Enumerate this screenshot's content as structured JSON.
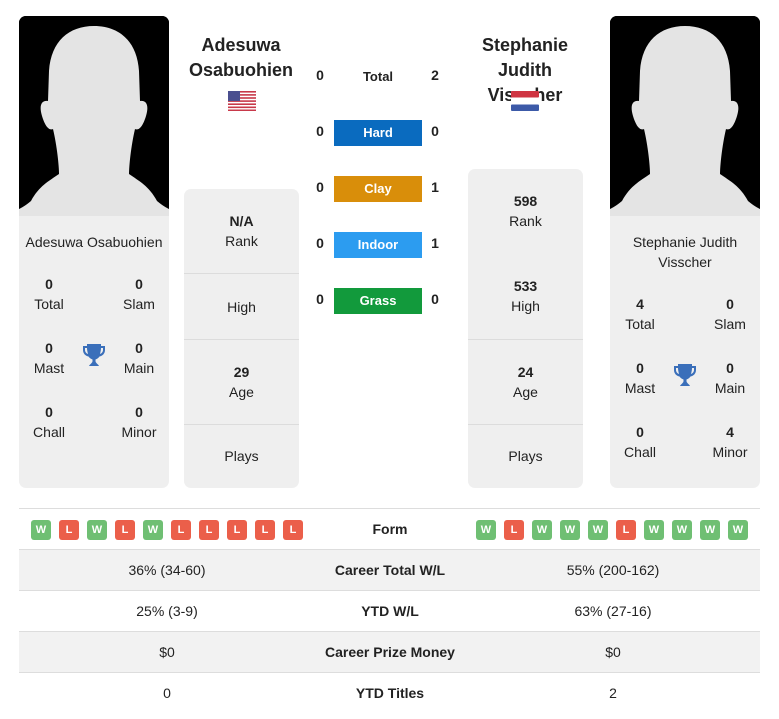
{
  "colors": {
    "hard": "#0a6bbf",
    "clay": "#d98e0a",
    "indoor": "#2c9cf0",
    "grass": "#129a3c",
    "win": "#6fbf73",
    "loss": "#eb5f4a",
    "trophy": "#3a6fba"
  },
  "player1": {
    "name": "Adesuwa Osabuohien",
    "name_line1": "Adesuwa",
    "name_line2": "Osabuohien",
    "flag": "us-flag",
    "card_name": "Adesuwa Osabuohien",
    "titles": {
      "total": {
        "value": "0",
        "label": "Total"
      },
      "slam": {
        "value": "0",
        "label": "Slam"
      },
      "mast": {
        "value": "0",
        "label": "Mast"
      },
      "main": {
        "value": "0",
        "label": "Main"
      },
      "chall": {
        "value": "0",
        "label": "Chall"
      },
      "minor": {
        "value": "0",
        "label": "Minor"
      }
    },
    "stats": {
      "rank": {
        "value": "N/A",
        "label": "Rank"
      },
      "high": {
        "value": "",
        "label": "High"
      },
      "age": {
        "value": "29",
        "label": "Age"
      },
      "plays": {
        "value": "",
        "label": "Plays"
      }
    },
    "form": [
      "W",
      "L",
      "W",
      "L",
      "W",
      "L",
      "L",
      "L",
      "L",
      "L"
    ],
    "career_wl": "36% (34-60)",
    "ytd_wl": "25% (3-9)",
    "prize_money": "$0",
    "ytd_titles": "0"
  },
  "player2": {
    "name": "Stephanie Judith Visscher",
    "name_line1": "Stephanie",
    "name_line2": "Judith Visscher",
    "flag": "nl-flag",
    "card_name_line1": "Stephanie Judith",
    "card_name_line2": "Visscher",
    "titles": {
      "total": {
        "value": "4",
        "label": "Total"
      },
      "slam": {
        "value": "0",
        "label": "Slam"
      },
      "mast": {
        "value": "0",
        "label": "Mast"
      },
      "main": {
        "value": "0",
        "label": "Main"
      },
      "chall": {
        "value": "0",
        "label": "Chall"
      },
      "minor": {
        "value": "4",
        "label": "Minor"
      }
    },
    "stats": {
      "rank": {
        "value": "598",
        "label": "Rank"
      },
      "high": {
        "value": "533",
        "label": "High"
      },
      "age": {
        "value": "24",
        "label": "Age"
      },
      "plays": {
        "value": "",
        "label": "Plays"
      }
    },
    "form": [
      "W",
      "L",
      "W",
      "W",
      "W",
      "L",
      "W",
      "W",
      "W",
      "W"
    ],
    "career_wl": "55% (200-162)",
    "ytd_wl": "63% (27-16)",
    "prize_money": "$0",
    "ytd_titles": "2"
  },
  "h2h": {
    "total": {
      "label": "Total",
      "p1": "0",
      "p2": "2"
    },
    "hard": {
      "label": "Hard",
      "p1": "0",
      "p2": "0"
    },
    "clay": {
      "label": "Clay",
      "p1": "0",
      "p2": "1"
    },
    "indoor": {
      "label": "Indoor",
      "p1": "0",
      "p2": "1"
    },
    "grass": {
      "label": "Grass",
      "p1": "0",
      "p2": "0"
    }
  },
  "table_labels": {
    "form": "Form",
    "career_wl": "Career Total W/L",
    "ytd_wl": "YTD W/L",
    "prize_money": "Career Prize Money",
    "ytd_titles": "YTD Titles"
  }
}
